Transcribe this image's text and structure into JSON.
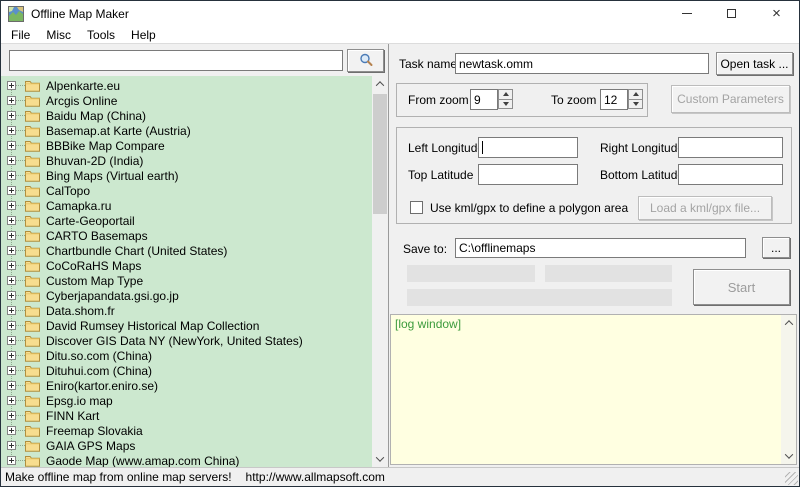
{
  "window": {
    "title": "Offline Map Maker"
  },
  "menu": {
    "items": [
      "File",
      "Misc",
      "Tools",
      "Help"
    ]
  },
  "search": {
    "value": ""
  },
  "tree": {
    "items": [
      "Alpenkarte.eu",
      "Arcgis Online",
      "Baidu Map (China)",
      "Basemap.at Karte (Austria)",
      "BBBike Map Compare",
      "Bhuvan-2D (India)",
      "Bing Maps (Virtual earth)",
      "CalTopo",
      "Camapka.ru",
      "Carte-Geoportail",
      "CARTO Basemaps",
      "Chartbundle Chart (United States)",
      "CoCoRaHS Maps",
      "Custom Map Type",
      "Cyberjapandata.gsi.go.jp",
      "Data.shom.fr",
      "David Rumsey Historical Map Collection",
      "Discover GIS Data NY (NewYork, United States)",
      "Ditu.so.com (China)",
      "Dituhui.com (China)",
      "Eniro(kartor.eniro.se)",
      "Epsg.io map",
      "FINN Kart",
      "Freemap Slovakia",
      "GAIA GPS Maps",
      "Gaode Map (www.amap.com China)"
    ]
  },
  "task": {
    "label": "Task name",
    "value": "newtask.omm",
    "open_button": "Open task ..."
  },
  "zoom": {
    "from_label": "From zoom",
    "from_value": "9",
    "to_label": "To zoom",
    "to_value": "12",
    "custom_parameters_button": "Custom Parameters"
  },
  "area": {
    "left_longitude_label": "Left Longitude",
    "left_longitude_value": "",
    "right_longitude_label": "Right Longitude",
    "right_longitude_value": "",
    "top_latitude_label": "Top Latitude",
    "top_latitude_value": "",
    "bottom_latitude_label": "Bottom Latitude",
    "bottom_latitude_value": "",
    "use_kml_label": "Use kml/gpx to define a polygon area",
    "kml_checked": false,
    "load_kml_button": "Load a kml/gpx file..."
  },
  "save": {
    "label": "Save to:",
    "value": "C:\\offlinemaps",
    "browse_button": "..."
  },
  "actions": {
    "start_button": "Start"
  },
  "log": {
    "text": "[log window]"
  },
  "status_bar": {
    "text": "Make offline map from online map servers!",
    "url": "http://www.allmapsoft.com"
  },
  "colors": {
    "tree_background": "#cce8cf",
    "log_background": "#ffffe1",
    "log_text": "#3c9b3c",
    "folder_fill": "#f7dd8f",
    "folder_stroke": "#b08f3e"
  }
}
